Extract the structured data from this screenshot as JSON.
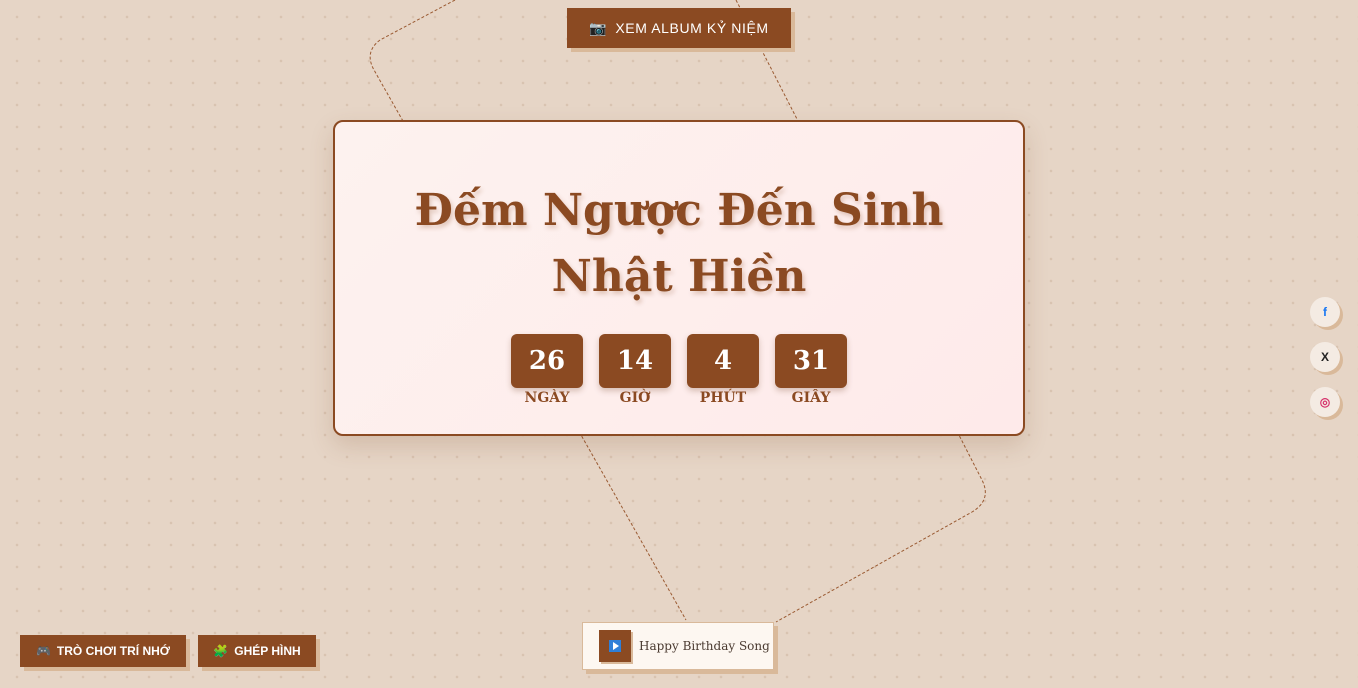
{
  "header": {
    "album_icon": "camera-icon",
    "album_label": "XEM ALBUM KỶ NIỆM"
  },
  "card": {
    "title": "Đếm Ngược Đến Sinh Nhật Hiền",
    "countdown": [
      {
        "value": "26",
        "label": "NGÀY"
      },
      {
        "value": "14",
        "label": "GIỜ"
      },
      {
        "value": "4",
        "label": "PHÚT"
      },
      {
        "value": "31",
        "label": "GIÂY"
      }
    ]
  },
  "social": {
    "facebook_glyph": "f",
    "x_glyph": "X",
    "instagram_glyph": "◎"
  },
  "games": {
    "memory_icon": "gamepad-icon",
    "memory_label": "TRÒ CHƠI TRÍ NHỚ",
    "puzzle_icon": "puzzle-icon",
    "puzzle_label": "GHÉP HÌNH"
  },
  "player": {
    "song_title": "Happy Birthday Song"
  },
  "colors": {
    "accent": "#8b4a22",
    "background": "#f2e5da",
    "shadow": "#d9b99a"
  }
}
